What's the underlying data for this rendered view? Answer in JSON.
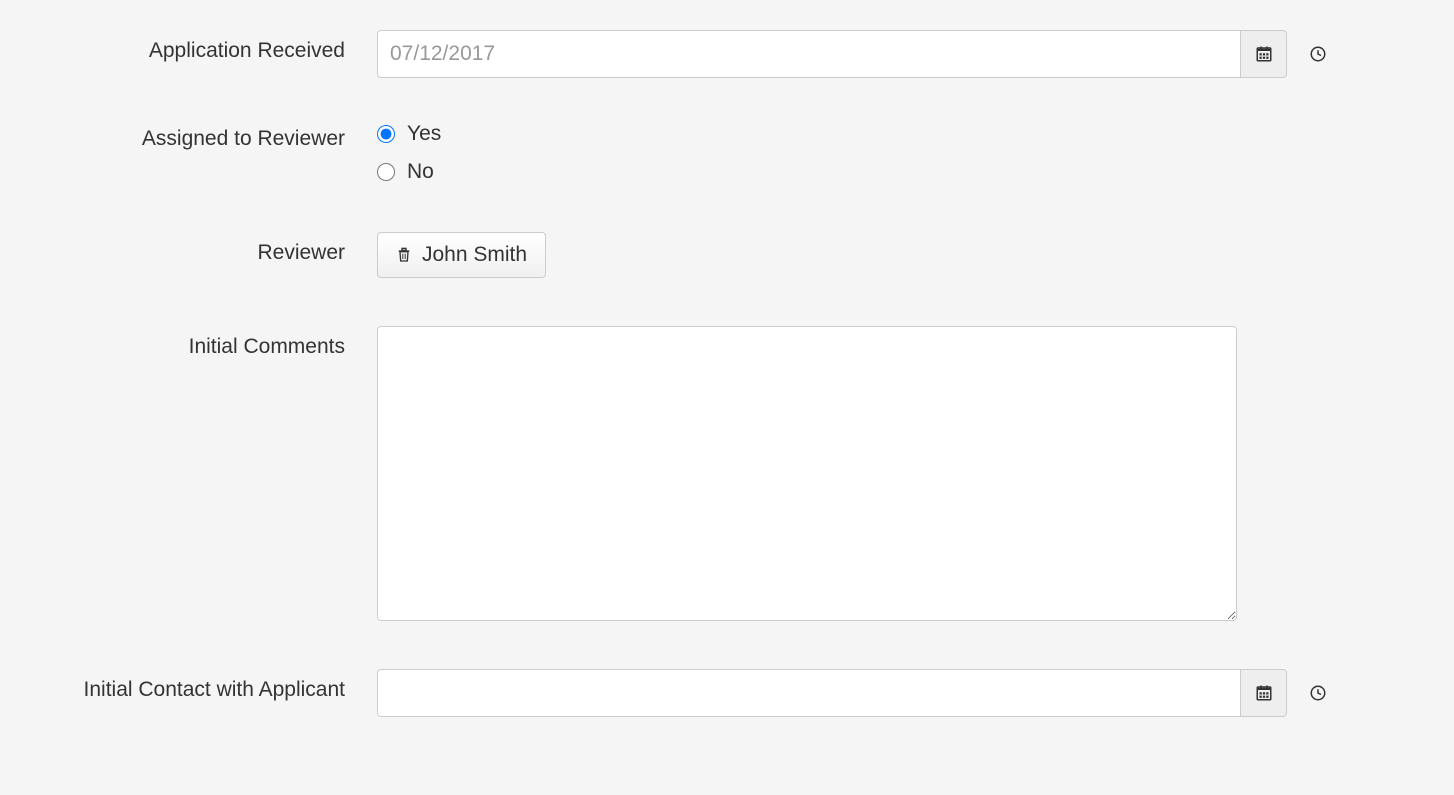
{
  "fields": {
    "application_received": {
      "label": "Application Received",
      "value": "",
      "placeholder": "07/12/2017"
    },
    "assigned_to_reviewer": {
      "label": "Assigned to Reviewer",
      "options": {
        "yes": "Yes",
        "no": "No"
      },
      "selected": "yes"
    },
    "reviewer": {
      "label": "Reviewer",
      "value": "John Smith"
    },
    "initial_comments": {
      "label": "Initial Comments",
      "value": ""
    },
    "initial_contact": {
      "label": "Initial Contact with Applicant",
      "value": "",
      "placeholder": ""
    }
  }
}
